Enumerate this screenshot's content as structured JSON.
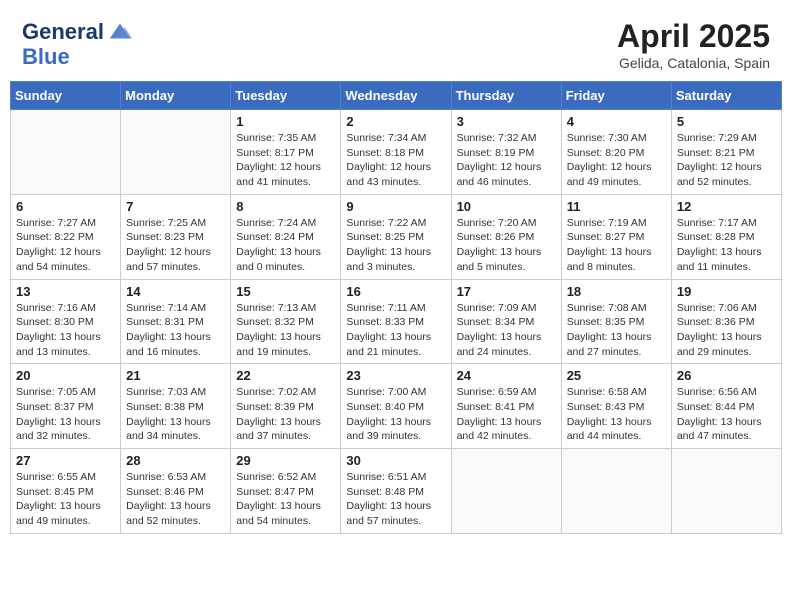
{
  "header": {
    "logo_line1": "General",
    "logo_line2": "Blue",
    "month_title": "April 2025",
    "location": "Gelida, Catalonia, Spain"
  },
  "days_of_week": [
    "Sunday",
    "Monday",
    "Tuesday",
    "Wednesday",
    "Thursday",
    "Friday",
    "Saturday"
  ],
  "weeks": [
    [
      {
        "day": "",
        "info": ""
      },
      {
        "day": "",
        "info": ""
      },
      {
        "day": "1",
        "info": "Sunrise: 7:35 AM\nSunset: 8:17 PM\nDaylight: 12 hours and 41 minutes."
      },
      {
        "day": "2",
        "info": "Sunrise: 7:34 AM\nSunset: 8:18 PM\nDaylight: 12 hours and 43 minutes."
      },
      {
        "day": "3",
        "info": "Sunrise: 7:32 AM\nSunset: 8:19 PM\nDaylight: 12 hours and 46 minutes."
      },
      {
        "day": "4",
        "info": "Sunrise: 7:30 AM\nSunset: 8:20 PM\nDaylight: 12 hours and 49 minutes."
      },
      {
        "day": "5",
        "info": "Sunrise: 7:29 AM\nSunset: 8:21 PM\nDaylight: 12 hours and 52 minutes."
      }
    ],
    [
      {
        "day": "6",
        "info": "Sunrise: 7:27 AM\nSunset: 8:22 PM\nDaylight: 12 hours and 54 minutes."
      },
      {
        "day": "7",
        "info": "Sunrise: 7:25 AM\nSunset: 8:23 PM\nDaylight: 12 hours and 57 minutes."
      },
      {
        "day": "8",
        "info": "Sunrise: 7:24 AM\nSunset: 8:24 PM\nDaylight: 13 hours and 0 minutes."
      },
      {
        "day": "9",
        "info": "Sunrise: 7:22 AM\nSunset: 8:25 PM\nDaylight: 13 hours and 3 minutes."
      },
      {
        "day": "10",
        "info": "Sunrise: 7:20 AM\nSunset: 8:26 PM\nDaylight: 13 hours and 5 minutes."
      },
      {
        "day": "11",
        "info": "Sunrise: 7:19 AM\nSunset: 8:27 PM\nDaylight: 13 hours and 8 minutes."
      },
      {
        "day": "12",
        "info": "Sunrise: 7:17 AM\nSunset: 8:28 PM\nDaylight: 13 hours and 11 minutes."
      }
    ],
    [
      {
        "day": "13",
        "info": "Sunrise: 7:16 AM\nSunset: 8:30 PM\nDaylight: 13 hours and 13 minutes."
      },
      {
        "day": "14",
        "info": "Sunrise: 7:14 AM\nSunset: 8:31 PM\nDaylight: 13 hours and 16 minutes."
      },
      {
        "day": "15",
        "info": "Sunrise: 7:13 AM\nSunset: 8:32 PM\nDaylight: 13 hours and 19 minutes."
      },
      {
        "day": "16",
        "info": "Sunrise: 7:11 AM\nSunset: 8:33 PM\nDaylight: 13 hours and 21 minutes."
      },
      {
        "day": "17",
        "info": "Sunrise: 7:09 AM\nSunset: 8:34 PM\nDaylight: 13 hours and 24 minutes."
      },
      {
        "day": "18",
        "info": "Sunrise: 7:08 AM\nSunset: 8:35 PM\nDaylight: 13 hours and 27 minutes."
      },
      {
        "day": "19",
        "info": "Sunrise: 7:06 AM\nSunset: 8:36 PM\nDaylight: 13 hours and 29 minutes."
      }
    ],
    [
      {
        "day": "20",
        "info": "Sunrise: 7:05 AM\nSunset: 8:37 PM\nDaylight: 13 hours and 32 minutes."
      },
      {
        "day": "21",
        "info": "Sunrise: 7:03 AM\nSunset: 8:38 PM\nDaylight: 13 hours and 34 minutes."
      },
      {
        "day": "22",
        "info": "Sunrise: 7:02 AM\nSunset: 8:39 PM\nDaylight: 13 hours and 37 minutes."
      },
      {
        "day": "23",
        "info": "Sunrise: 7:00 AM\nSunset: 8:40 PM\nDaylight: 13 hours and 39 minutes."
      },
      {
        "day": "24",
        "info": "Sunrise: 6:59 AM\nSunset: 8:41 PM\nDaylight: 13 hours and 42 minutes."
      },
      {
        "day": "25",
        "info": "Sunrise: 6:58 AM\nSunset: 8:43 PM\nDaylight: 13 hours and 44 minutes."
      },
      {
        "day": "26",
        "info": "Sunrise: 6:56 AM\nSunset: 8:44 PM\nDaylight: 13 hours and 47 minutes."
      }
    ],
    [
      {
        "day": "27",
        "info": "Sunrise: 6:55 AM\nSunset: 8:45 PM\nDaylight: 13 hours and 49 minutes."
      },
      {
        "day": "28",
        "info": "Sunrise: 6:53 AM\nSunset: 8:46 PM\nDaylight: 13 hours and 52 minutes."
      },
      {
        "day": "29",
        "info": "Sunrise: 6:52 AM\nSunset: 8:47 PM\nDaylight: 13 hours and 54 minutes."
      },
      {
        "day": "30",
        "info": "Sunrise: 6:51 AM\nSunset: 8:48 PM\nDaylight: 13 hours and 57 minutes."
      },
      {
        "day": "",
        "info": ""
      },
      {
        "day": "",
        "info": ""
      },
      {
        "day": "",
        "info": ""
      }
    ]
  ]
}
